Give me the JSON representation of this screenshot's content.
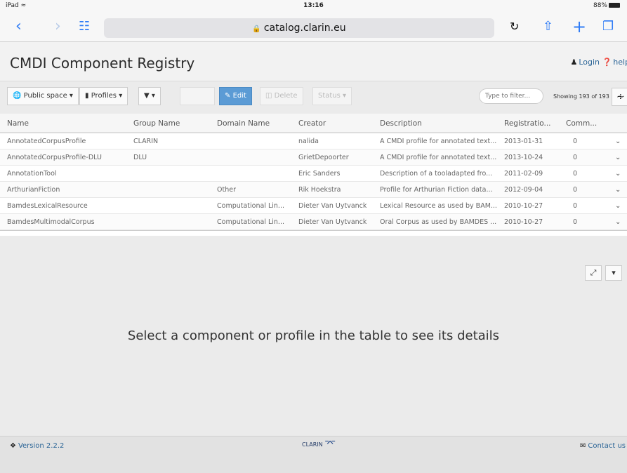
{
  "status_bar": {
    "carrier": "iPad",
    "wifi_icon": "wifi-icon",
    "time": "13:16",
    "battery": "88%"
  },
  "browser": {
    "url": "catalog.clarin.eu",
    "back_icon": "back-icon",
    "forward_icon": "forward-icon",
    "bookmarks_icon": "book-icon",
    "reload_icon": "reload-icon",
    "share_icon": "share-icon",
    "new_tab_icon": "plus-icon",
    "tabs_icon": "tabs-icon"
  },
  "header": {
    "title": "CMDI Component Registry",
    "login": "Login",
    "help": "help"
  },
  "toolbar": {
    "space": "Public space",
    "type": "Profiles",
    "filter_button": "",
    "edit": "Edit",
    "delete": "Delete",
    "status": "Status",
    "filter_placeholder": "Type to filter...",
    "showing": "Showing 193 of 193"
  },
  "table": {
    "columns": [
      "Name",
      "Group Name",
      "Domain Name",
      "Creator",
      "Description",
      "Registratio...",
      "Comm..."
    ],
    "rows": [
      {
        "name": "AnnotatedCorpusProfile",
        "group": "CLARIN",
        "domain": "",
        "creator": "nalida",
        "description": "A CMDI profile for annotated text...",
        "date": "2013-01-31",
        "comments": "0"
      },
      {
        "name": "AnnotatedCorpusProfile-DLU",
        "group": "DLU",
        "domain": "",
        "creator": "GrietDepoorter",
        "description": "A CMDI profile for annotated text...",
        "date": "2013-10-24",
        "comments": "0"
      },
      {
        "name": "AnnotationTool",
        "group": "",
        "domain": "",
        "creator": "Eric Sanders",
        "description": "Description of a tooladapted fro...",
        "date": "2011-02-09",
        "comments": "0"
      },
      {
        "name": "ArthurianFiction",
        "group": "",
        "domain": "Other",
        "creator": "Rik Hoekstra",
        "description": "Profile for Arthurian Fiction data...",
        "date": "2012-09-04",
        "comments": "0"
      },
      {
        "name": "BamdesLexicalResource",
        "group": "",
        "domain": "Computational Lin...",
        "creator": "Dieter Van Uytvanck",
        "description": "Lexical Resource as used by BAM...",
        "date": "2010-10-27",
        "comments": "0"
      },
      {
        "name": "BamdesMultimodalCorpus",
        "group": "",
        "domain": "Computational Lin...",
        "creator": "Dieter Van Uytvanck",
        "description": "Oral Corpus as used by BAMDES ...",
        "date": "2010-10-27",
        "comments": "0"
      }
    ]
  },
  "details_message": "Select a component or profile in the table to see its details",
  "footer": {
    "version": "Version 2.2.2",
    "logo_text": "CLARIN",
    "contact": "Contact us"
  }
}
